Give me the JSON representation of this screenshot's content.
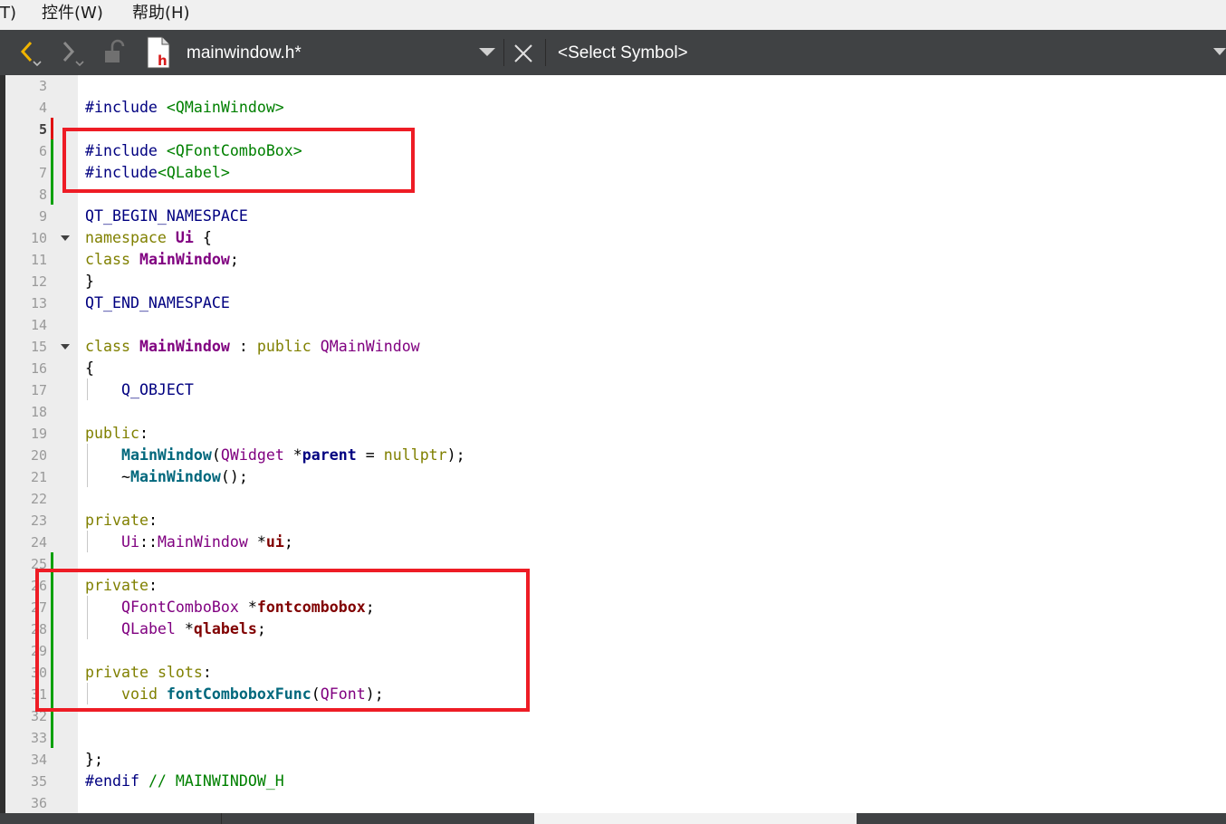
{
  "menubar": {
    "items": [
      {
        "label": "T)"
      },
      {
        "label": "控件(W)"
      },
      {
        "label": "帮助(H)"
      }
    ]
  },
  "toolbar": {
    "file_name": "mainwindow.h*",
    "symbol_selector": "<Select Symbol>",
    "icons": [
      "back-arrow-icon",
      "forward-arrow-icon",
      "lock-icon",
      "header-file-icon",
      "dropdown-chevron-icon",
      "close-icon"
    ]
  },
  "editor": {
    "current_line": 5,
    "line_numbers": [
      "3",
      "4",
      "5",
      "6",
      "7",
      "8",
      "9",
      "10",
      "11",
      "12",
      "13",
      "14",
      "15",
      "16",
      "17",
      "18",
      "19",
      "20",
      "21",
      "22",
      "23",
      "24",
      "25",
      "26",
      "27",
      "28",
      "29",
      "30",
      "31",
      "32",
      "33",
      "34",
      "35",
      "36"
    ],
    "fold_lines": [
      10,
      15
    ],
    "changes": {
      "removed_line": 5,
      "added_ranges": [
        [
          5,
          8
        ],
        [
          25,
          33
        ]
      ]
    },
    "lines": [
      {
        "n": "3",
        "segs": []
      },
      {
        "n": "4",
        "segs": [
          {
            "t": "#include ",
            "c": "pp"
          },
          {
            "t": "<QMainWindow>",
            "c": "inc"
          }
        ]
      },
      {
        "n": "5",
        "segs": []
      },
      {
        "n": "6",
        "segs": [
          {
            "t": "#include ",
            "c": "pp"
          },
          {
            "t": "<QFontComboBox>",
            "c": "inc"
          }
        ]
      },
      {
        "n": "7",
        "segs": [
          {
            "t": "#include",
            "c": "pp"
          },
          {
            "t": "<QLabel>",
            "c": "inc"
          }
        ]
      },
      {
        "n": "8",
        "segs": []
      },
      {
        "n": "9",
        "segs": [
          {
            "t": "QT_BEGIN_NAMESPACE",
            "c": "mac"
          }
        ]
      },
      {
        "n": "10",
        "segs": [
          {
            "t": "namespace ",
            "c": "kw"
          },
          {
            "t": "Ui",
            "c": "clsb"
          },
          {
            "t": " {",
            "c": ""
          }
        ]
      },
      {
        "n": "11",
        "segs": [
          {
            "t": "class ",
            "c": "kw"
          },
          {
            "t": "MainWindow",
            "c": "clsb"
          },
          {
            "t": ";",
            "c": ""
          }
        ]
      },
      {
        "n": "12",
        "segs": [
          {
            "t": "}",
            "c": ""
          }
        ]
      },
      {
        "n": "13",
        "segs": [
          {
            "t": "QT_END_NAMESPACE",
            "c": "mac"
          }
        ]
      },
      {
        "n": "14",
        "segs": []
      },
      {
        "n": "15",
        "segs": [
          {
            "t": "class ",
            "c": "kw"
          },
          {
            "t": "MainWindow",
            "c": "clsb"
          },
          {
            "t": " : ",
            "c": ""
          },
          {
            "t": "public ",
            "c": "kw"
          },
          {
            "t": "QMainWindow",
            "c": "cls"
          }
        ]
      },
      {
        "n": "16",
        "segs": [
          {
            "t": "{",
            "c": ""
          }
        ]
      },
      {
        "n": "17",
        "segs": [
          {
            "t": "    ",
            "c": ""
          },
          {
            "t": "Q_OBJECT",
            "c": "mac"
          }
        ]
      },
      {
        "n": "18",
        "segs": []
      },
      {
        "n": "19",
        "segs": [
          {
            "t": "public",
            "c": "kw"
          },
          {
            "t": ":",
            "c": ""
          }
        ]
      },
      {
        "n": "20",
        "segs": [
          {
            "t": "    ",
            "c": ""
          },
          {
            "t": "MainWindow",
            "c": "fn"
          },
          {
            "t": "(",
            "c": ""
          },
          {
            "t": "QWidget",
            "c": "cls"
          },
          {
            "t": " *",
            "c": ""
          },
          {
            "t": "parent",
            "c": "prm"
          },
          {
            "t": " = ",
            "c": ""
          },
          {
            "t": "nullptr",
            "c": "kw"
          },
          {
            "t": ");",
            "c": ""
          }
        ]
      },
      {
        "n": "21",
        "segs": [
          {
            "t": "    ~",
            "c": ""
          },
          {
            "t": "MainWindow",
            "c": "fn"
          },
          {
            "t": "();",
            "c": ""
          }
        ]
      },
      {
        "n": "22",
        "segs": []
      },
      {
        "n": "23",
        "segs": [
          {
            "t": "private",
            "c": "kw"
          },
          {
            "t": ":",
            "c": ""
          }
        ]
      },
      {
        "n": "24",
        "segs": [
          {
            "t": "    ",
            "c": ""
          },
          {
            "t": "Ui",
            "c": "cls"
          },
          {
            "t": "::",
            "c": ""
          },
          {
            "t": "MainWindow",
            "c": "cls"
          },
          {
            "t": " *",
            "c": ""
          },
          {
            "t": "ui",
            "c": "mem"
          },
          {
            "t": ";",
            "c": ""
          }
        ]
      },
      {
        "n": "25",
        "segs": []
      },
      {
        "n": "26",
        "segs": [
          {
            "t": "private",
            "c": "kw"
          },
          {
            "t": ":",
            "c": ""
          }
        ]
      },
      {
        "n": "27",
        "segs": [
          {
            "t": "    ",
            "c": ""
          },
          {
            "t": "QFontComboBox",
            "c": "cls"
          },
          {
            "t": " *",
            "c": ""
          },
          {
            "t": "fontcombobox",
            "c": "mem"
          },
          {
            "t": ";",
            "c": ""
          }
        ]
      },
      {
        "n": "28",
        "segs": [
          {
            "t": "    ",
            "c": ""
          },
          {
            "t": "QLabel",
            "c": "cls"
          },
          {
            "t": " *",
            "c": ""
          },
          {
            "t": "qlabels",
            "c": "mem"
          },
          {
            "t": ";",
            "c": ""
          }
        ]
      },
      {
        "n": "29",
        "segs": []
      },
      {
        "n": "30",
        "segs": [
          {
            "t": "private ",
            "c": "kw"
          },
          {
            "t": "slots",
            "c": "kw"
          },
          {
            "t": ":",
            "c": ""
          }
        ]
      },
      {
        "n": "31",
        "segs": [
          {
            "t": "    ",
            "c": ""
          },
          {
            "t": "void ",
            "c": "kw"
          },
          {
            "t": "fontComboboxFunc",
            "c": "fn"
          },
          {
            "t": "(",
            "c": ""
          },
          {
            "t": "QFont",
            "c": "cls"
          },
          {
            "t": ");",
            "c": ""
          }
        ]
      },
      {
        "n": "32",
        "segs": []
      },
      {
        "n": "33",
        "segs": []
      },
      {
        "n": "34",
        "segs": [
          {
            "t": "};",
            "c": ""
          }
        ]
      },
      {
        "n": "35",
        "segs": [
          {
            "t": "#endif ",
            "c": "pp"
          },
          {
            "t": "// MAINWINDOW_H",
            "c": "cmt"
          }
        ]
      },
      {
        "n": "36",
        "segs": []
      }
    ]
  },
  "colors": {
    "toolbar_bg": "#404244",
    "annotation_red": "#ee1c25",
    "added_green": "#00a000",
    "removed_red": "#e01010"
  }
}
